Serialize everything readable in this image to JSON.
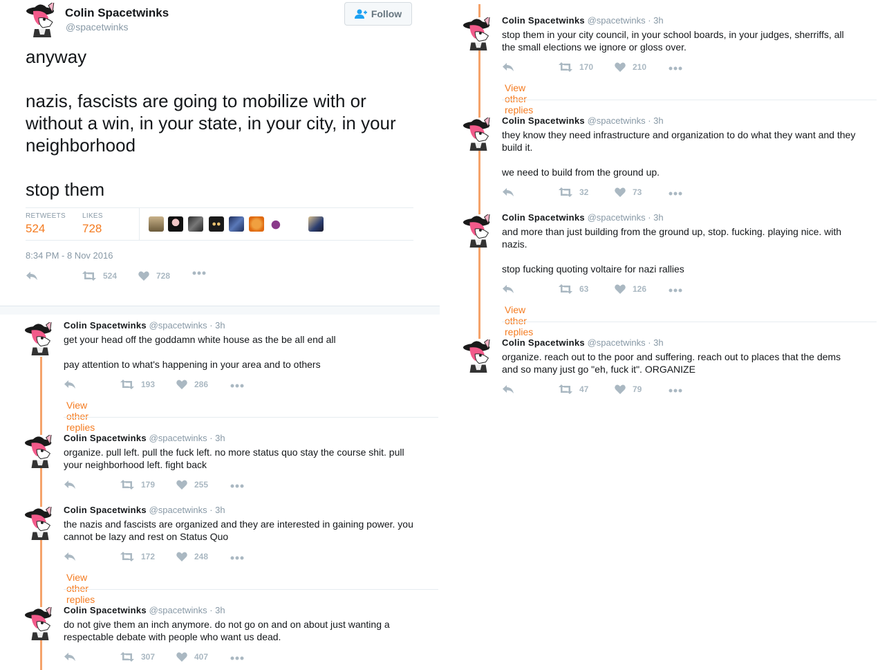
{
  "user": {
    "name": "Colin Spacetwinks",
    "handle": "@spacetwinks"
  },
  "follow_label": "Follow",
  "main_tweet": {
    "paragraphs": [
      "anyway",
      "nazis, fascists are going to mobilize with or without a win, in your state, in your city, in your neighborhood",
      "stop them"
    ],
    "retweets_label": "RETWEETS",
    "retweets": "524",
    "likes_label": "LIKES",
    "likes": "728",
    "timestamp": "8:34 PM - 8 Nov 2016",
    "action_retweets": "524",
    "action_likes": "728"
  },
  "meta_time": "· 3h",
  "view_other_replies": "View other replies",
  "replies_left": [
    {
      "paragraphs": [
        "get your head off the goddamn white house as the be all end all",
        "pay attention to what's happening in your area and to others"
      ],
      "retweets": "193",
      "likes": "286"
    },
    {
      "paragraphs": [
        "organize. pull left. pull the fuck left. no more status quo stay the course shit. pull your neighborhood left. fight back"
      ],
      "retweets": "179",
      "likes": "255"
    },
    {
      "paragraphs": [
        "the nazis and fascists are organized and they are interested in gaining power. you cannot be lazy and rest on Status Quo"
      ],
      "retweets": "172",
      "likes": "248"
    },
    {
      "paragraphs": [
        "do not give them an inch anymore. do not go on and on about just wanting a respectable debate with people who want us dead."
      ],
      "retweets": "307",
      "likes": "407"
    }
  ],
  "replies_right": [
    {
      "paragraphs": [
        "stop them in your city council, in your school boards, in your judges, sherriffs, all the small elections we ignore or gloss over."
      ],
      "retweets": "170",
      "likes": "210"
    },
    {
      "paragraphs": [
        "they know they need infrastructure and organization to do what they want and they build it.",
        "we need to build from the ground up."
      ],
      "retweets": "32",
      "likes": "73"
    },
    {
      "paragraphs": [
        "and more than just building from the ground up, stop. fucking. playing nice. with nazis.",
        "stop fucking quoting voltaire for nazi rallies"
      ],
      "retweets": "63",
      "likes": "126"
    },
    {
      "paragraphs": [
        "organize. reach out to the poor and suffering. reach out to places that the dems and so many just go \"eh, fuck it\". ORGANIZE"
      ],
      "retweets": "47",
      "likes": "79"
    }
  ],
  "colors": {
    "accent": "#f47b20",
    "thread_line": "#f5a36b",
    "muted": "#8899a6",
    "icon": "#aab8c2"
  }
}
